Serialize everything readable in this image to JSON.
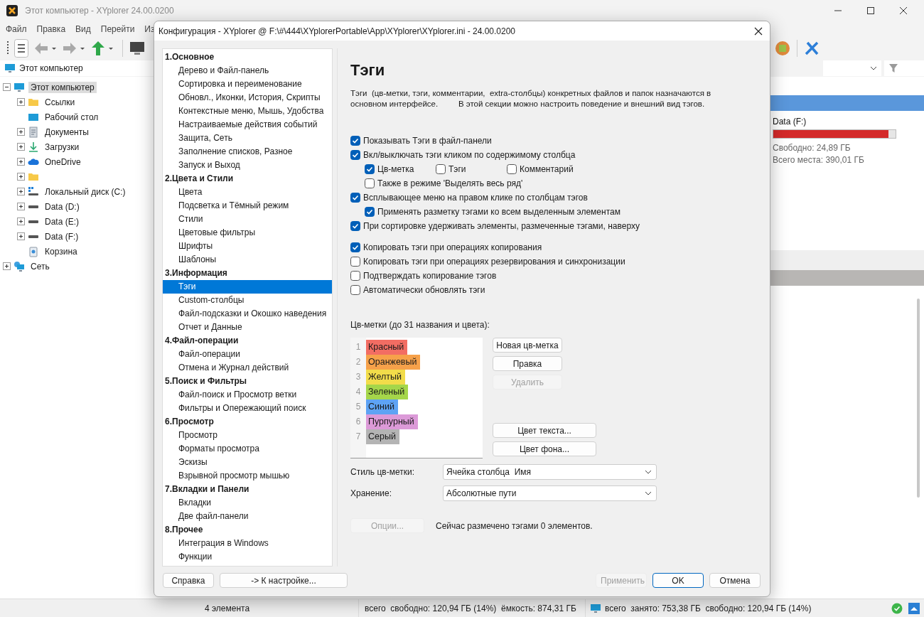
{
  "app": {
    "title": "Этот компьютер - XYplorer 24.00.0200",
    "menu": [
      "Файл",
      "Правка",
      "Вид",
      "Перейти",
      "Из"
    ],
    "location": "Этот компьютер",
    "tree": [
      {
        "label": "Этот компьютер",
        "kind": "computer",
        "expanded": true,
        "selected": true,
        "children": [
          {
            "label": "Ссылки",
            "kind": "folder",
            "expanded": false,
            "selected": false
          },
          {
            "label": "Рабочий стол",
            "kind": "desktop",
            "selected": false
          },
          {
            "label": "Документы",
            "kind": "documents",
            "expanded": false,
            "selected": false
          },
          {
            "label": "Загрузки",
            "kind": "download",
            "expanded": false,
            "selected": false
          },
          {
            "label": "OneDrive",
            "kind": "cloud",
            "expanded": false,
            "selected": false
          },
          {
            "kind": "folder",
            "expanded": false,
            "selected": false
          },
          {
            "label": "Локальный диск (C:)",
            "kind": "system-drive",
            "expanded": false,
            "selected": false
          },
          {
            "label": "Data (D:)",
            "kind": "drive",
            "expanded": false,
            "selected": false
          },
          {
            "label": "Data (E:)",
            "kind": "drive",
            "expanded": false,
            "selected": false
          },
          {
            "label": "Data (F:)",
            "kind": "drive",
            "expanded": false,
            "selected": false
          },
          {
            "label": "Корзина",
            "kind": "recycle",
            "selected": false
          }
        ]
      },
      {
        "label": "Сеть",
        "kind": "network",
        "expanded": false,
        "selected": false
      }
    ],
    "drive": {
      "name": "Data (F:)",
      "level": 0.94,
      "free": "Свободно: 24,89 ГБ",
      "total": "Всего места: 390,01 ГБ"
    },
    "status": {
      "items": "4 элемента",
      "totals": "всего  свободно: 120,94 ГБ (14%)  ёмкость: 874,31 ГБ",
      "drive": "всего  занято: 753,38 ГБ  свободно: 120,94 ГБ (14%)"
    }
  },
  "dialog": {
    "title": "Конфигурация - XYplorer @ F:\\#\\444\\XYplorerPortable\\App\\XYplorer\\XYplorer.ini - 24.00.0200",
    "nav": [
      {
        "title": "1.Основное",
        "items": [
          {
            "label": "Дерево и Файл-панель",
            "selected": false
          },
          {
            "label": "Сортировка и переименование",
            "selected": false
          },
          {
            "label": "Обновл., Иконки, История, Скрипты",
            "selected": false
          },
          {
            "label": "Контекстные меню, Мышь, Удобства",
            "selected": false
          },
          {
            "label": "Настраиваемые действия событий",
            "selected": false
          },
          {
            "label": "Защита, Сеть",
            "selected": false
          },
          {
            "label": "Заполнение списков, Разное",
            "selected": false
          },
          {
            "label": "Запуск и Выход",
            "selected": false
          }
        ]
      },
      {
        "title": "2.Цвета и Стили",
        "items": [
          {
            "label": "Цвета",
            "selected": false
          },
          {
            "label": "Подсветка и Тёмный режим",
            "selected": false
          },
          {
            "label": "Стили",
            "selected": false
          },
          {
            "label": "Цветовые фильтры",
            "selected": false
          },
          {
            "label": "Шрифты",
            "selected": false
          },
          {
            "label": "Шаблоны",
            "selected": false
          }
        ]
      },
      {
        "title": "3.Информация",
        "items": [
          {
            "label": "Тэги",
            "selected": true
          },
          {
            "label": "Custom-столбцы",
            "selected": false
          },
          {
            "label": "Файл-подсказки и Окошко наведения",
            "selected": false
          },
          {
            "label": "Отчет и Данные",
            "selected": false
          }
        ]
      },
      {
        "title": "4.Файл-операции",
        "items": [
          {
            "label": "Файл-операции",
            "selected": false
          },
          {
            "label": "Отмена и Журнал действий",
            "selected": false
          }
        ]
      },
      {
        "title": "5.Поиск и Фильтры",
        "items": [
          {
            "label": "Файл-поиск и Просмотр ветки",
            "selected": false
          },
          {
            "label": "Фильтры и Опережающий поиск",
            "selected": false
          }
        ]
      },
      {
        "title": "6.Просмотр",
        "items": [
          {
            "label": "Просмотр",
            "selected": false
          },
          {
            "label": "Форматы просмотра",
            "selected": false
          },
          {
            "label": "Эскизы",
            "selected": false
          },
          {
            "label": "Взрывной просмотр мышью",
            "selected": false
          }
        ]
      },
      {
        "title": "7.Вкладки и Панели",
        "items": [
          {
            "label": "Вкладки",
            "selected": false
          },
          {
            "label": "Две файл-панели",
            "selected": false
          }
        ]
      },
      {
        "title": "8.Прочее",
        "items": [
          {
            "label": "Интеграция в Windows",
            "selected": false
          },
          {
            "label": "Функции",
            "selected": false
          }
        ]
      }
    ],
    "heading": "Тэги",
    "description": "Тэги  (цв-метки, тэги, комментарии,  extra-столбцы) конкретных файлов и папок назначаются в\nосновном интерфейсе.         В этой секции можно настроить поведение и внешний вид тэгов.",
    "option_groups": [
      [
        {
          "label": "Показывать Тэги в файл-панели",
          "checked": true
        },
        {
          "label": "Вкл/выключать тэги кликом по содержимому столбца",
          "checked": true,
          "children": [
            {
              "items": [
                {
                  "label": "Цв-метка",
                  "checked": true
                },
                {
                  "label": "Тэги",
                  "checked": false
                },
                {
                  "label": "Комментарий",
                  "checked": false
                }
              ]
            },
            {
              "items": [
                {
                  "label": "Также в режиме 'Выделять весь ряд'",
                  "checked": false
                }
              ]
            }
          ]
        },
        {
          "label": "Всплывающее меню на правом клике по столбцам тэгов",
          "checked": true,
          "children": [
            {
              "items": [
                {
                  "label": "Применять разметку тэгами ко всем выделенным элементам",
                  "checked": true
                }
              ]
            }
          ]
        },
        {
          "label": "При сортировке удерживать элементы, размеченные тэгами, наверху",
          "checked": true
        }
      ],
      [
        {
          "label": "Копировать тэги при операциях копирования",
          "checked": true
        },
        {
          "label": "Копировать тэги при операциях резервирования и синхронизации",
          "checked": false
        },
        {
          "label": "Подтверждать копирование тэгов",
          "checked": false
        },
        {
          "label": "Автоматически обновлять тэги",
          "checked": false
        }
      ]
    ],
    "labels_title": "Цв-метки (до 31 названия и цвета):",
    "labels": [
      {
        "number": "1",
        "name": "Красный",
        "color": "#f26d63"
      },
      {
        "number": "2",
        "name": "Оранжевый",
        "color": "#f6a14a"
      },
      {
        "number": "3",
        "name": "Желтый",
        "color": "#f2dc4a"
      },
      {
        "number": "4",
        "name": "Зеленый",
        "color": "#a5d64a"
      },
      {
        "number": "5",
        "name": "Синий",
        "color": "#5ea3f4"
      },
      {
        "number": "6",
        "name": "Пурпурный",
        "color": "#dc9ad8"
      },
      {
        "number": "7",
        "name": "Серый",
        "color": "#b4b4b4"
      }
    ],
    "label_buttons": [
      {
        "label": "Новая цв-метка",
        "disabled": false
      },
      {
        "label": "Правка",
        "disabled": false
      },
      {
        "label": "Удалить",
        "disabled": true
      }
    ],
    "color_buttons": [
      {
        "label": "Цвет текста...",
        "disabled": false
      },
      {
        "label": "Цвет фона...",
        "disabled": false
      }
    ],
    "selects": [
      {
        "label": "Стиль цв-метки:",
        "value": "Ячейка столбца  Имя"
      },
      {
        "label": "Хранение:",
        "value": "Абсолютные пути"
      }
    ],
    "options_button": {
      "label": "Опции...",
      "disabled": true
    },
    "tag_count": "Сейчас размечено тэгами 0 элементов.",
    "footer_left": [
      {
        "label": "Справка",
        "disabled": false
      },
      {
        "label": "-> К настройке...",
        "disabled": false
      }
    ],
    "footer_right": [
      {
        "label": "Применить",
        "disabled": true,
        "default": false
      },
      {
        "label": "OK",
        "disabled": false,
        "default": true
      },
      {
        "label": "Отмена",
        "disabled": false,
        "default": false
      }
    ]
  }
}
